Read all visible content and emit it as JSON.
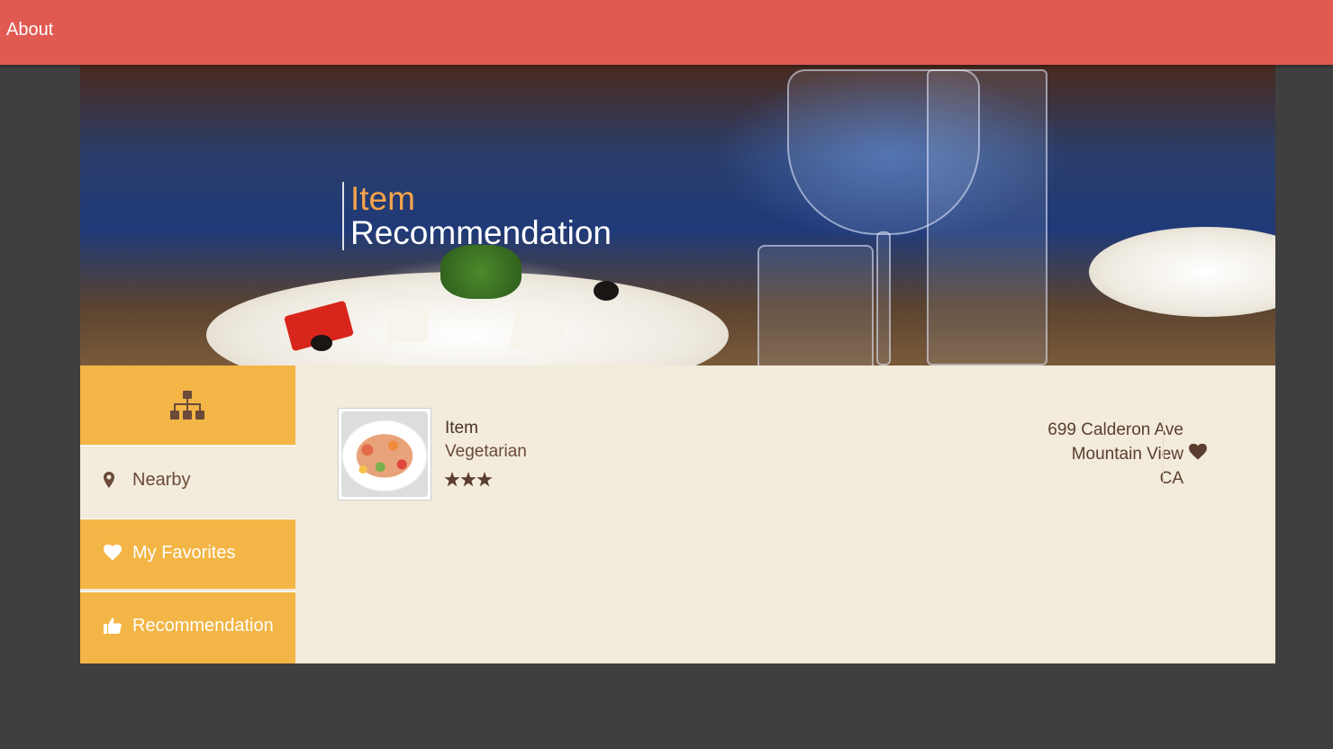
{
  "topbar": {
    "about_label": "About",
    "color": "#e05a52"
  },
  "hero": {
    "title_line1": "Item",
    "title_line2": "Recommendation"
  },
  "sidebar": {
    "header_icon": "sitemap-icon",
    "items": [
      {
        "label": "Nearby",
        "icon": "map-marker-icon"
      },
      {
        "label": "My Favorites",
        "icon": "heart-icon"
      },
      {
        "label": "Recommendation",
        "icon": "thumbs-up-icon"
      }
    ]
  },
  "results": [
    {
      "name": "Item",
      "category": "Vegetarian",
      "rating": 3,
      "address": [
        "699 Calderon Ave",
        "Mountain View",
        "CA"
      ],
      "favorite_icon": "heart-icon"
    }
  ],
  "colors": {
    "accent": "#f3b545",
    "background": "#3f3f3f",
    "panel": "#f3ebdb",
    "title_accent": "#f5a34a"
  }
}
